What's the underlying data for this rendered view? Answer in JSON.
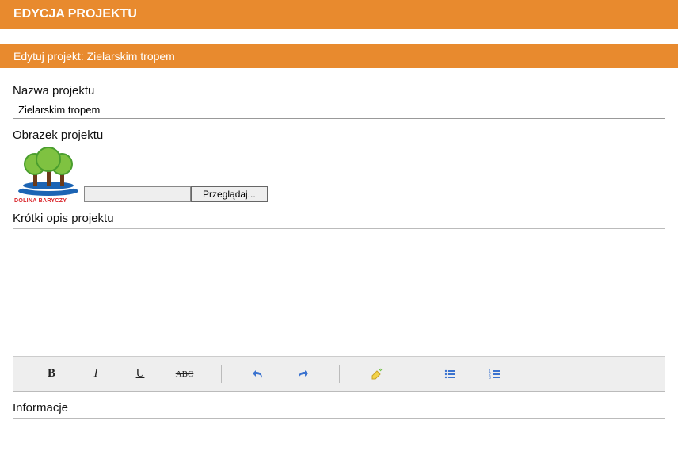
{
  "header": {
    "title": "EDYCJA PROJEKTU"
  },
  "subheader": {
    "title": "Edytuj projekt: Zielarskim tropem"
  },
  "fields": {
    "name_label": "Nazwa projektu",
    "name_value": "Zielarskim tropem",
    "image_label": "Obrazek projektu",
    "browse_label": "Przeglądaj...",
    "short_desc_label": "Krótki opis projektu",
    "info_label": "Informacje",
    "logo_caption": "DOLINA BARYCZY"
  },
  "toolbar": {
    "bold": "B",
    "italic": "I",
    "underline": "U",
    "strike": "ABC"
  }
}
